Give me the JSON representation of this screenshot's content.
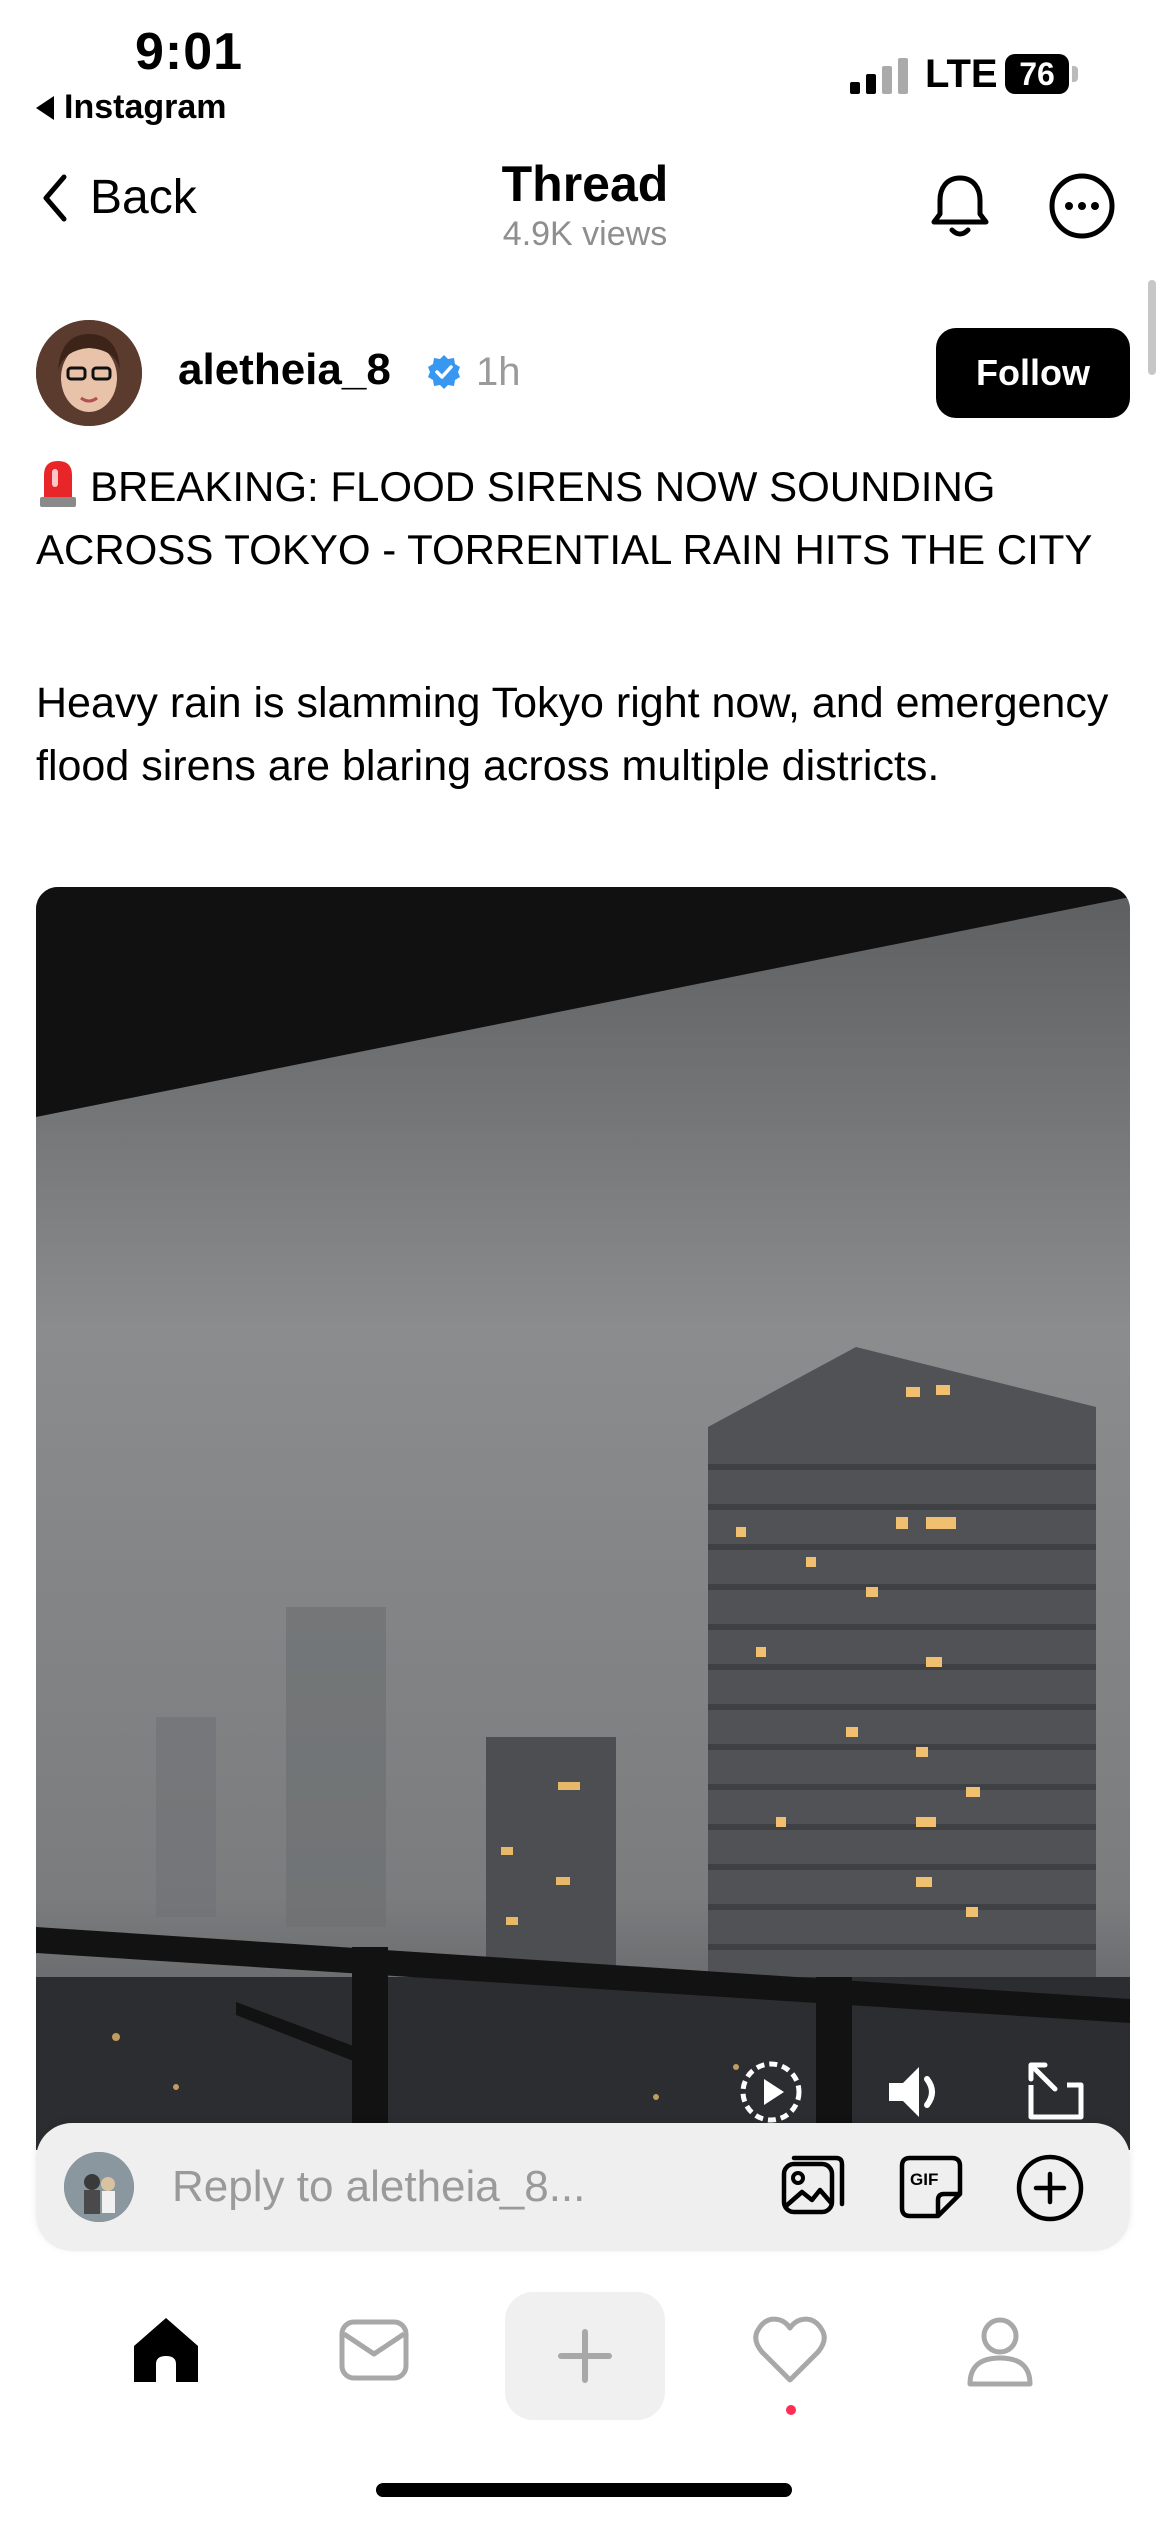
{
  "status_bar": {
    "time": "9:01",
    "back_app": "Instagram",
    "network": "LTE",
    "battery": "76"
  },
  "header": {
    "back_label": "Back",
    "title": "Thread",
    "views": "4.9K views"
  },
  "post": {
    "author": "aletheia_8",
    "time_ago": "1h",
    "follow_label": "Follow",
    "headline": "BREAKING: FLOOD SIRENS NOW SOUNDING ACROSS TOKYO - TORRENTIAL RAIN HITS THE CITY",
    "body": "Heavy rain is slamming Tokyo right now, and emergency flood sirens are blaring across multiple districts."
  },
  "reply": {
    "placeholder": "Reply to aletheia_8...",
    "gif_label": "GIF"
  },
  "icons": {
    "status": [
      "signal-icon",
      "battery-icon"
    ],
    "header": [
      "chevron-left-icon",
      "bell-icon",
      "more-icon"
    ],
    "video": [
      "replay-icon",
      "volume-icon",
      "fullscreen-icon"
    ],
    "reply": [
      "photo-icon",
      "gif-icon",
      "add-icon"
    ],
    "tabs": [
      "home-icon",
      "inbox-icon",
      "plus-icon",
      "heart-icon",
      "profile-icon"
    ]
  },
  "colors": {
    "accent_verified": "#3897f0",
    "notification_dot": "#ff2d55",
    "follow_bg": "#000000"
  }
}
